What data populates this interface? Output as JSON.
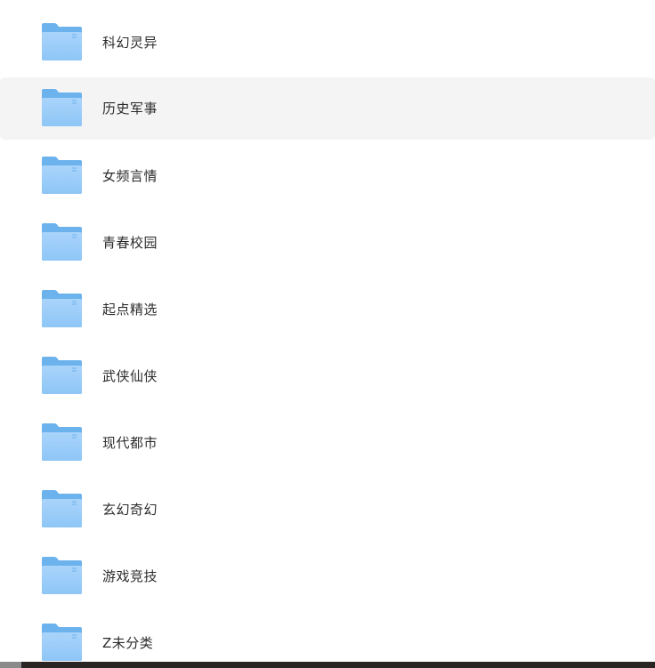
{
  "colors": {
    "folder_back": "#6cb2ec",
    "folder_front_top": "#a9d4fb",
    "folder_front_bottom": "#8ec6f6",
    "hover_background": "#f4f4f4",
    "label_text": "#2b2b2b"
  },
  "folders": [
    {
      "label": "科幻灵异",
      "icon": "folder-icon",
      "hovered": false
    },
    {
      "label": "历史军事",
      "icon": "folder-icon",
      "hovered": true
    },
    {
      "label": "女频言情",
      "icon": "folder-icon",
      "hovered": false
    },
    {
      "label": "青春校园",
      "icon": "folder-icon",
      "hovered": false
    },
    {
      "label": "起点精选",
      "icon": "folder-icon",
      "hovered": false
    },
    {
      "label": "武侠仙侠",
      "icon": "folder-icon",
      "hovered": false
    },
    {
      "label": "现代都市",
      "icon": "folder-icon",
      "hovered": false
    },
    {
      "label": "玄幻奇幻",
      "icon": "folder-icon",
      "hovered": false
    },
    {
      "label": "游戏竞技",
      "icon": "folder-icon",
      "hovered": false
    },
    {
      "label": "Z未分类",
      "icon": "folder-icon",
      "hovered": false
    }
  ]
}
